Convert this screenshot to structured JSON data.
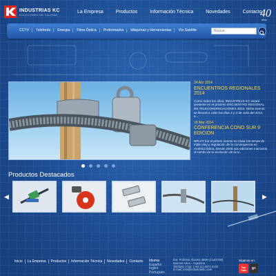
{
  "header": {
    "brand": "INDUSTRIAS KC",
    "brand_sub": "SOLUCIONES DE CALIDAD",
    "nav": [
      "La Empresa",
      "Productos",
      "Información Técnica",
      "Novedades",
      "Contacto"
    ],
    "anniversary": "40 años"
  },
  "subnav": {
    "items": [
      "CCTV",
      "Telefonía",
      "Energía",
      "Fibra Óptica",
      "Preformados",
      "Máquinas y Herramientas",
      "Vía Satélite"
    ],
    "search_placeholder": "Buscar"
  },
  "slider": {
    "dots": 5,
    "active": 0
  },
  "news": [
    {
      "date": "24 Abr 2014",
      "title": "ENCUENTROS REGIONALES 2014",
      "body": "Como todos los años, INDUSTRIAS KC estará presente en el próximo ENCUENTRO REGIONAL DE TELECOMUNICACIONES 2014. Dicho evento se llevará a cabo los días 2 y 3 de Julio del 2014, e..."
    },
    {
      "date": "18 Mar 2014",
      "title": "CONFERENCIA CONO SUR 9 EDICION",
      "body": "NPLAY fue el primer evento en tratar los temas de triple play y regulación de la convergencia en América latina. Desde 2006 sus ediciones marcaron el rumbo de la evolución de la tv..."
    }
  ],
  "products": {
    "title": "Productos Destacados",
    "prev": "◀",
    "next": "▶"
  },
  "footer": {
    "links": [
      "Inicio",
      "La Empresa",
      "Productos",
      "Información Técnica",
      "Novedades",
      "Contacto"
    ],
    "lang_label": "Idioma",
    "languages": [
      "Español",
      "Inglés",
      "Portugués"
    ],
    "address": [
      "Ent. Profesor Álvarez 3666 (C1407GB)",
      "Buenos Aires - Argentina",
      "Teléfono / Fax: (+54 11) 4671-2222",
      "E-mail: info@industriaskc.com"
    ],
    "follow": "Síganos en:",
    "youtube": "You Tube",
    "gplus": "g+"
  },
  "colors": {
    "background": "#1f4f96",
    "accent": "#ffd93b",
    "subnav": "#2f6bbd",
    "logo_red": "#e0231c"
  }
}
